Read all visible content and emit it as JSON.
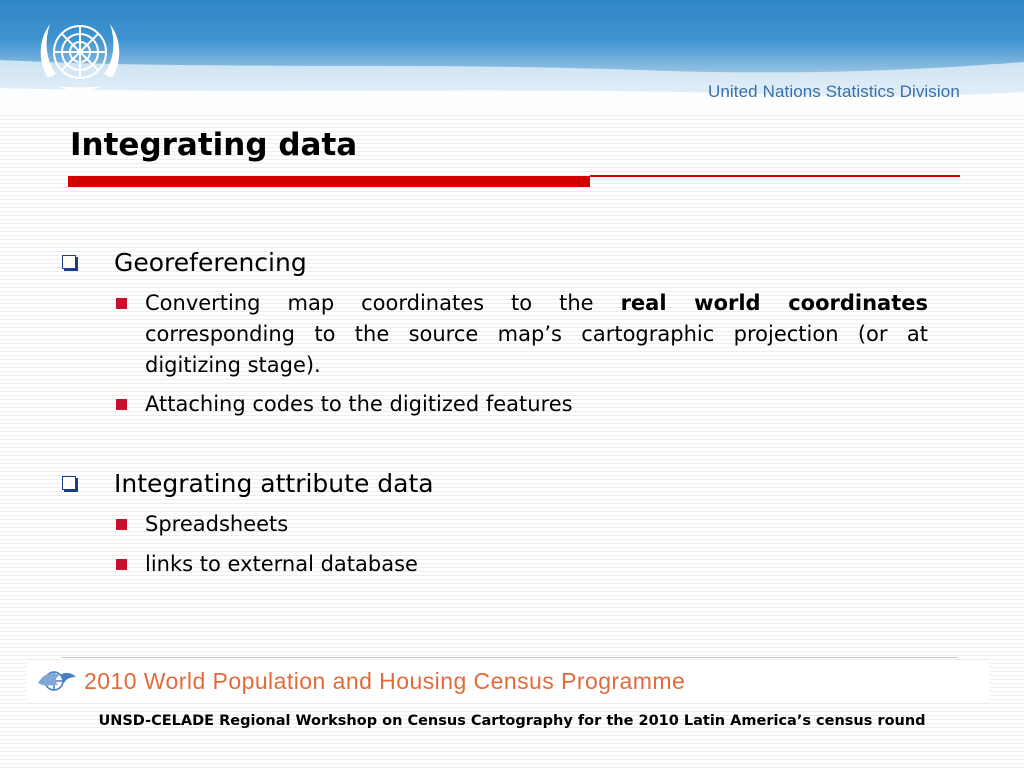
{
  "header": {
    "logo_icon": "un-emblem-icon",
    "division": "United Nations Statistics Division"
  },
  "slide": {
    "title": "Integrating data",
    "accent_color": "#d40000",
    "bullets": [
      {
        "label": "Georeferencing",
        "sub": [
          {
            "pre": "Converting map coordinates to the ",
            "bold": "real world coordinates",
            "post": " corresponding to the source map’s cartographic projection (or at digitizing stage)."
          },
          {
            "text": "Attaching codes to the digitized features"
          }
        ]
      },
      {
        "label": "Integrating attribute data",
        "sub": [
          {
            "text": "Spreadsheets"
          },
          {
            "text": "links to external database"
          }
        ]
      }
    ]
  },
  "banner": {
    "icon": "census-dove-icon",
    "text": "2010 World Population and Housing Census Programme",
    "color": "#e36a3a"
  },
  "footer": {
    "text": "UNSD-CELADE Regional Workshop on Census Cartography for the 2010 Latin America’s census round"
  }
}
